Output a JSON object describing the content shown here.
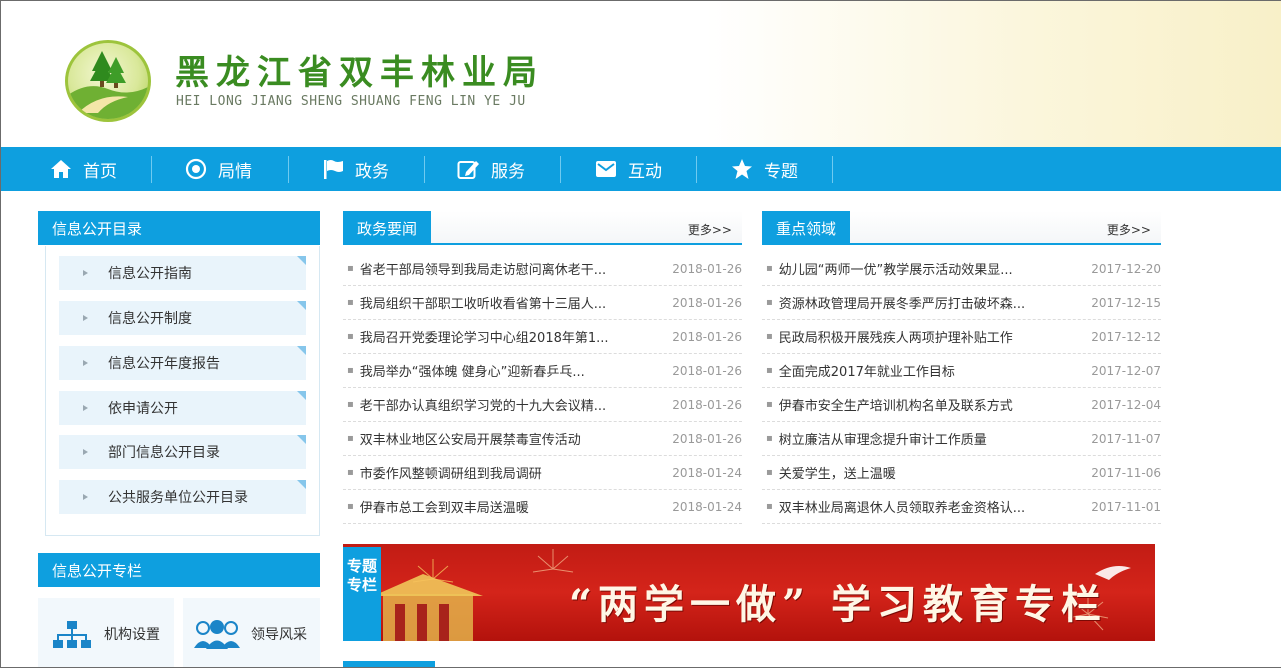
{
  "header": {
    "title": "黑龙江省双丰林业局",
    "subtitle": "HEI LONG JIANG SHENG SHUANG FENG LIN YE JU"
  },
  "nav": {
    "items": [
      {
        "label": "首页",
        "icon": "home-icon"
      },
      {
        "label": "局情",
        "icon": "target-icon"
      },
      {
        "label": "政务",
        "icon": "flag-icon"
      },
      {
        "label": "服务",
        "icon": "edit-icon"
      },
      {
        "label": "互动",
        "icon": "mail-icon"
      },
      {
        "label": "专题",
        "icon": "star-icon"
      }
    ]
  },
  "sidebar": {
    "catalog_title": "信息公开目录",
    "items": [
      {
        "label": "信息公开指南"
      },
      {
        "label": "信息公开制度"
      },
      {
        "label": "信息公开年度报告"
      },
      {
        "label": "依申请公开"
      },
      {
        "label": "部门信息公开目录"
      },
      {
        "label": "公共服务单位公开目录"
      }
    ],
    "column_title": "信息公开专栏",
    "tiles": [
      {
        "label": "机构设置",
        "icon": "org-chart-icon"
      },
      {
        "label": "领导风采",
        "icon": "people-icon"
      }
    ]
  },
  "news": {
    "title": "政务要闻",
    "more": "更多>>",
    "items": [
      {
        "title": "省老干部局领导到我局走访慰问离休老干...",
        "date": "2018-01-26"
      },
      {
        "title": "我局组织干部职工收听收看省第十三届人...",
        "date": "2018-01-26"
      },
      {
        "title": "我局召开党委理论学习中心组2018年第1...",
        "date": "2018-01-26"
      },
      {
        "title": "我局举办“强体魄 健身心”迎新春乒乓...",
        "date": "2018-01-26"
      },
      {
        "title": "老干部办认真组织学习党的十九大会议精...",
        "date": "2018-01-26"
      },
      {
        "title": "双丰林业地区公安局开展禁毒宣传活动",
        "date": "2018-01-26"
      },
      {
        "title": "市委作风整顿调研组到我局调研",
        "date": "2018-01-24"
      },
      {
        "title": "伊春市总工会到双丰局送温暖",
        "date": "2018-01-24"
      }
    ]
  },
  "key_areas": {
    "title": "重点领域",
    "more": "更多>>",
    "items": [
      {
        "title": "幼儿园“两师一优”教学展示活动效果显...",
        "date": "2017-12-20"
      },
      {
        "title": "资源林政管理局开展冬季严厉打击破坏森...",
        "date": "2017-12-15"
      },
      {
        "title": "民政局积极开展残疾人两项护理补贴工作",
        "date": "2017-12-12"
      },
      {
        "title": "全面完成2017年就业工作目标",
        "date": "2017-12-07"
      },
      {
        "title": "伊春市安全生产培训机构名单及联系方式",
        "date": "2017-12-04"
      },
      {
        "title": "树立廉洁从审理念提升审计工作质量",
        "date": "2017-11-07"
      },
      {
        "title": "关爱学生，送上温暖",
        "date": "2017-11-06"
      },
      {
        "title": "双丰林业局离退休人员领取养老金资格认...",
        "date": "2017-11-01"
      }
    ]
  },
  "banner": {
    "tag": "专题专栏",
    "text": "“两学一做” 学习教育专栏"
  },
  "colors": {
    "primary": "#0e9fdf",
    "logo_green": "#3a8c21",
    "banner_red": "#c21c14"
  }
}
